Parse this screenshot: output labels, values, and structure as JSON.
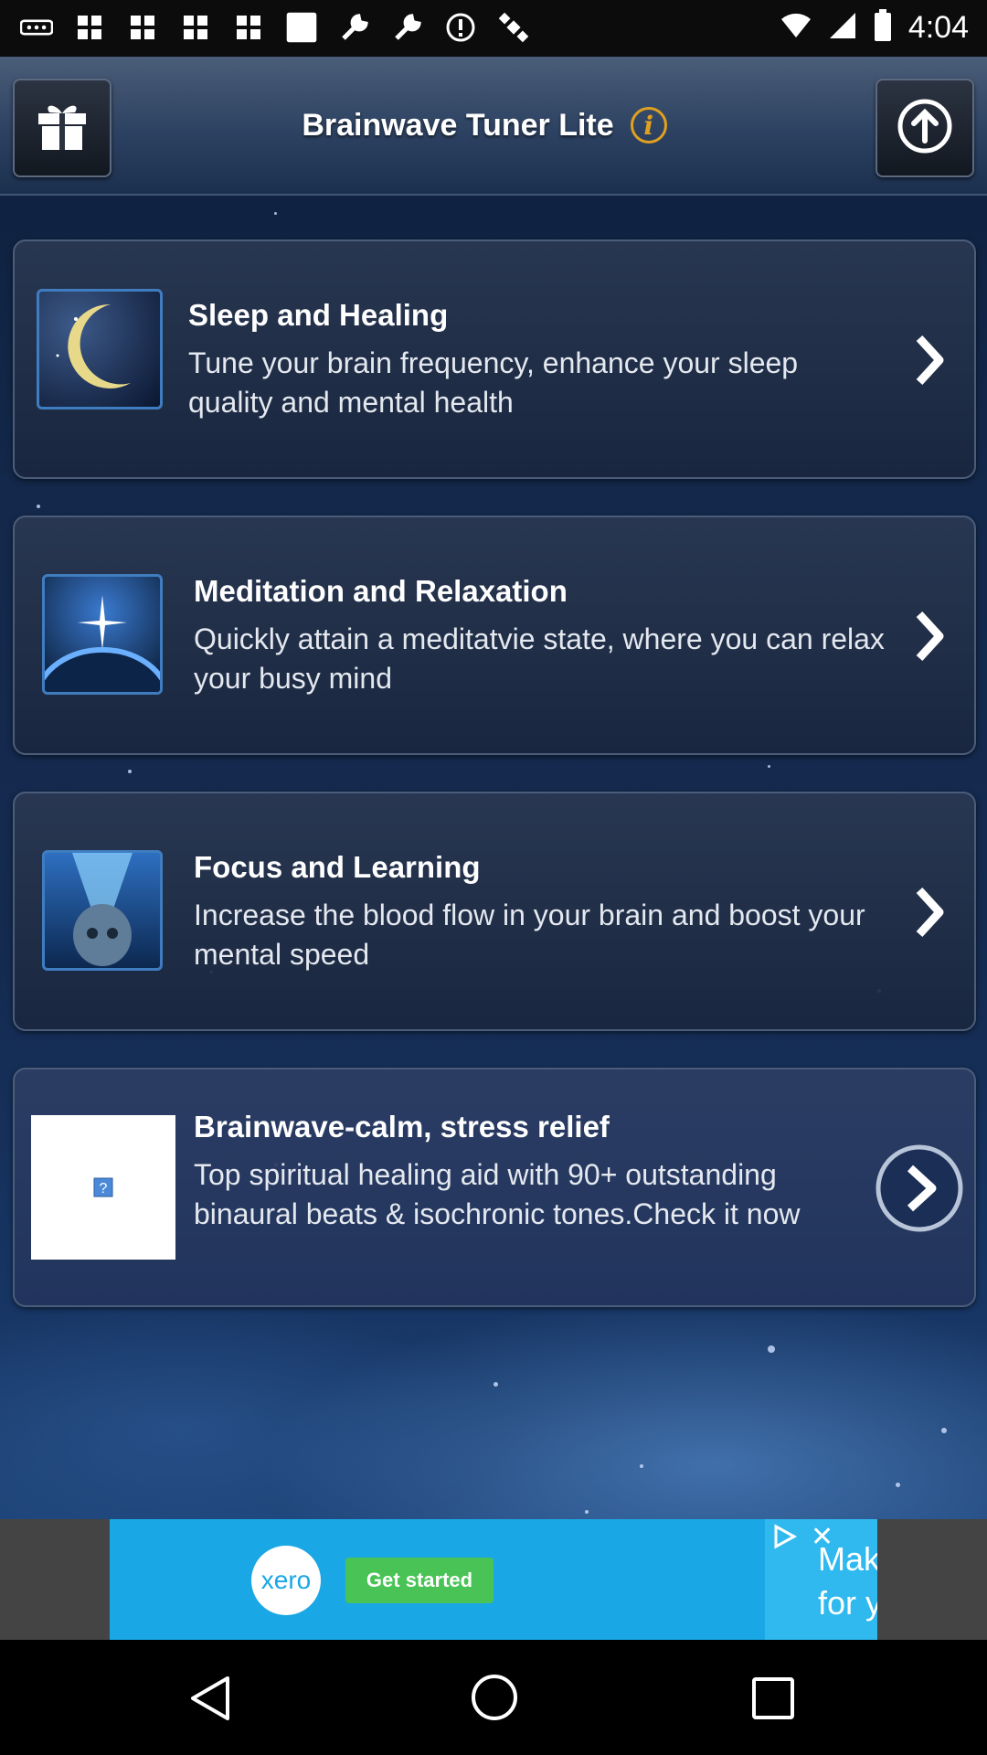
{
  "status_bar": {
    "time": "4:04",
    "left_icons": [
      "more-icon",
      "grid-icon",
      "grid-icon",
      "grid-icon",
      "grid-icon",
      "square-icon",
      "wrench-icon",
      "wrench-icon",
      "circle-icon",
      "satellite-icon"
    ],
    "right_icons": [
      "wifi-icon",
      "signal-icon",
      "battery-icon"
    ]
  },
  "header": {
    "title": "Brainwave Tuner Lite",
    "info_glyph": "i"
  },
  "items": [
    {
      "title": "Sleep and Healing",
      "desc": "Tune your brain frequency, enhance your sleep quality and mental health",
      "icon": "moon-icon"
    },
    {
      "title": "Meditation and Relaxation",
      "desc": "Quickly attain a meditatvie state, where you can relax your busy mind",
      "icon": "star-planet-icon"
    },
    {
      "title": "Focus and Learning",
      "desc": "Increase the blood flow in your brain and boost your mental speed",
      "icon": "brain-head-icon"
    },
    {
      "title": "Brainwave-calm, stress relief",
      "desc": "Top spiritual healing aid with 90+ outstanding binaural beats & isochronic tones.Check it now",
      "icon": "broken-image-icon"
    }
  ],
  "ad": {
    "brand": "xero",
    "cta": "Get started",
    "partial_text": "Mak\nfor y"
  },
  "colors": {
    "accent_info": "#e0a020",
    "ad_blue": "#1aa7e5",
    "cta_green": "#49c355"
  }
}
